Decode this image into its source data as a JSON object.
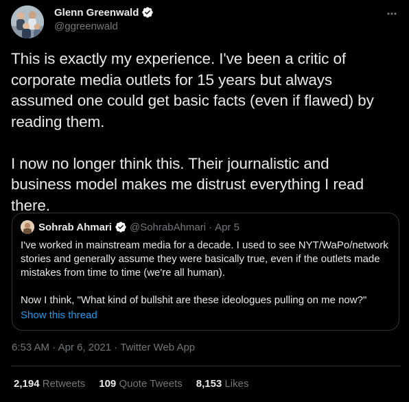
{
  "colors": {
    "background": "#000000",
    "text_primary": "#e7e9ea",
    "text_secondary": "#71767b",
    "link": "#1d9bf0",
    "border": "#2f3336",
    "verified": "#ffffff"
  },
  "author": {
    "display_name": "Glenn Greenwald",
    "handle": "@ggreenwald",
    "verified": true,
    "avatar_icon": "avatar-photo",
    "more_icon": "more-dots-icon"
  },
  "tweet": {
    "text": "This is exactly my experience. I've been a critic of\ncorporate media outlets for 15 years but always\nassumed one could get basic facts (even if flawed) by\nreading them.\n\nI now no longer think this. Their journalistic and\nbusiness model makes me distrust everything I read\nthere."
  },
  "quote": {
    "display_name": "Sohrab Ahmari",
    "handle": "@SohrabAhmari",
    "separator": "·",
    "date": "Apr 5",
    "text": "I've worked in mainstream media for a decade. I used to see NYT/WaPo/network\nstories and generally assume they were basically true, even if the outlets made\nmistakes from time to time (we're all human).\n\nNow I think, \"What kind of bullshit are these ideologues pulling on me now?\"",
    "show_thread": "Show this thread"
  },
  "meta": {
    "time": "6:53 AM",
    "separator": "·",
    "date": "Apr 6, 2021",
    "source": "Twitter Web App"
  },
  "stats": {
    "retweets_count": "2,194",
    "retweets_label": "Retweets",
    "quotes_count": "109",
    "quotes_label": "Quote Tweets",
    "likes_count": "8,153",
    "likes_label": "Likes"
  }
}
